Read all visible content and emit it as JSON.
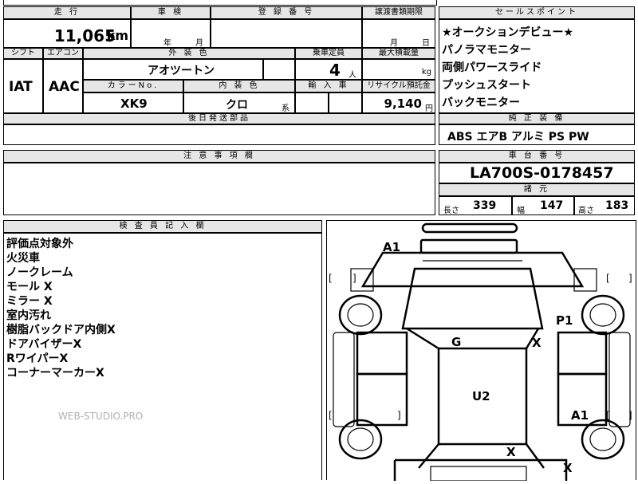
{
  "top_strip": {
    "fragment_1": "",
    "fragment_2": ""
  },
  "headers": {
    "mileage": "走 行",
    "shaken": "車 検",
    "registration": "登 録 番 号",
    "transfer_deadline": "譲渡書類期限",
    "sales_points": "セールスポイント",
    "shift": "シフト",
    "aircon": "エアコン",
    "exterior_color": "外 装 色",
    "capacity": "乗車定員",
    "max_load": "最大積載量",
    "color_no": "カラーNo.",
    "interior_color": "内 装 色",
    "import": "輸 入 車",
    "recycle_fee": "リサイクル預託金",
    "later_parts": "後日発送部品",
    "standard_equipment": "純 正 装 備",
    "notes": "注 意 事 項 欄",
    "chassis_number": "車 台 番 号",
    "specs": "諸 元",
    "inspector_notes": "検 査 員 記 入 欄"
  },
  "units": {
    "km": "km",
    "year": "年",
    "month": "月",
    "day": "日",
    "persons": "人",
    "kg": "kg",
    "yen": "円",
    "kei": "系"
  },
  "values": {
    "mileage": "11,065",
    "shift": "IAT",
    "aircon": "AAC",
    "exterior_color": "アオツートン",
    "capacity": "4",
    "color_no": "XK9",
    "interior_color": "クロ",
    "recycle_fee": "9,140"
  },
  "sales_points": [
    "★オークションデビュー★",
    "パノラマモニター",
    "両側パワースライド",
    "プッシュスタート",
    "バックモニター"
  ],
  "standard_equipment": "ABS エアB アルミ PS PW",
  "chassis_number": "LA700S-0178457",
  "specs": {
    "length_label": "長さ",
    "length": "339",
    "width_label": "幅",
    "width": "147",
    "height_label": "高さ",
    "height": "183"
  },
  "inspector_notes": [
    "評価点対象外",
    "火災車",
    "ノークレーム",
    "モール X",
    "ミラー X",
    "室内汚れ",
    "樹脂バックドア内側X",
    "ドアバイザーX",
    "RワイパーX",
    "コーナーマーカーX"
  ],
  "watermark": "WEB-STUDIO.PRO",
  "damage_marks": {
    "a1_front": "A1",
    "p1": "P1",
    "g": "G",
    "x_windshield": "X",
    "u2": "U2",
    "a1_rear": "A1",
    "x_rear_left": "X",
    "x_rear_right": "X",
    "bracket_open": "[",
    "bracket_close": "]"
  }
}
